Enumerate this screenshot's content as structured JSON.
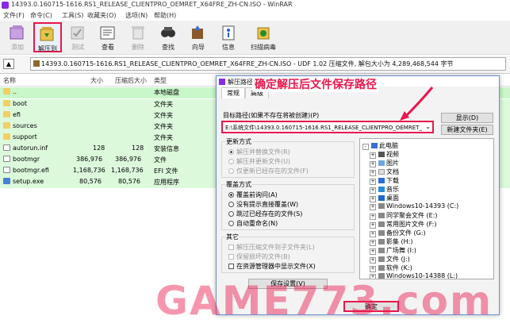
{
  "window": {
    "title": "14393.0.160715-1616.RS1_RELEASE_CLIENTPRO_OEMRET_X64FRE_ZH-CN.ISO - WinRAR"
  },
  "menu": [
    "文件(F)",
    "命令(C)",
    "工具(S)",
    "收藏夹(O)",
    "选项(N)",
    "帮助(H)"
  ],
  "toolbar": [
    {
      "label": "添加",
      "icon": "add-icon",
      "disabled": true
    },
    {
      "label": "解压到",
      "icon": "extract-to-icon",
      "highlighted": true
    },
    {
      "label": "测试",
      "icon": "test-icon",
      "disabled": true
    },
    {
      "label": "查看",
      "icon": "view-icon"
    },
    {
      "label": "删除",
      "icon": "delete-icon",
      "disabled": true
    },
    {
      "label": "查找",
      "icon": "find-icon"
    },
    {
      "label": "向导",
      "icon": "wizard-icon"
    },
    {
      "label": "信息",
      "icon": "info-icon"
    },
    {
      "label": "扫描病毒",
      "icon": "virus-scan-icon"
    }
  ],
  "address": {
    "path": "14393.0.160715-1616.RS1_RELEASE_CLIENTPRO_OEMRET_X64FRE_ZH-CN.ISO - UDF 1.02 压缩文件, 解包大小为 4,289,468,544 字节"
  },
  "columns": {
    "name": "名称",
    "size": "大小",
    "packed": "压缩后大小",
    "type": "类型"
  },
  "files": [
    {
      "name": "..",
      "size": "",
      "packed": "",
      "type": "本地磁盘",
      "kind": "folder"
    },
    {
      "name": "boot",
      "size": "",
      "packed": "",
      "type": "文件夹",
      "kind": "folder"
    },
    {
      "name": "efi",
      "size": "",
      "packed": "",
      "type": "文件夹",
      "kind": "folder"
    },
    {
      "name": "sources",
      "size": "",
      "packed": "",
      "type": "文件夹",
      "kind": "folder"
    },
    {
      "name": "support",
      "size": "",
      "packed": "",
      "type": "文件夹",
      "kind": "folder"
    },
    {
      "name": "autorun.inf",
      "size": "128",
      "packed": "128",
      "type": "安装信息",
      "kind": "file"
    },
    {
      "name": "bootmgr",
      "size": "386,976",
      "packed": "386,976",
      "type": "文件",
      "kind": "file"
    },
    {
      "name": "bootmgr.efi",
      "size": "1,168,736",
      "packed": "1,168,736",
      "type": "EFI 文件",
      "kind": "file"
    },
    {
      "name": "setup.exe",
      "size": "80,576",
      "packed": "80,576",
      "type": "应用程序",
      "kind": "exe"
    }
  ],
  "dialog": {
    "title": "解压路径和选项",
    "tabs": [
      "常规",
      "高级"
    ],
    "dest_label": "目标路径(如果不存在将被创建)(P)",
    "dest_value": "E:\\系统文件\\14393.0.160715-1616.RS1_RELEASE_CLIENTPRO_OEMRET_",
    "show_button": "显示(D)",
    "new_folder_button": "新建文件夹(E)",
    "update_mode": {
      "title": "更新方式",
      "options": [
        "解压并替换文件(R)",
        "解压并更新文件(U)",
        "仅更新已经存在的文件(F)"
      ]
    },
    "overwrite_mode": {
      "title": "覆盖方式",
      "options": [
        "覆盖前询问(A)",
        "没有提示直接覆盖(W)",
        "跳过已经存在的文件(S)",
        "自动重命名(N)"
      ]
    },
    "misc": {
      "title": "其它",
      "options": [
        "解压压缩文件到子文件夹(L)",
        "保留损坏的文件(B)",
        "在资源管理器中显示文件(X)"
      ]
    },
    "save_button": "保存设置(V)",
    "ok_button": "确定",
    "tree": [
      {
        "label": "此电脑",
        "level": 0
      },
      {
        "label": "视频",
        "level": 1
      },
      {
        "label": "图片",
        "level": 1
      },
      {
        "label": "文档",
        "level": 1
      },
      {
        "label": "下载",
        "level": 1
      },
      {
        "label": "音乐",
        "level": 1
      },
      {
        "label": "桌面",
        "level": 1
      },
      {
        "label": "Windows10-14393 (C:)",
        "level": 1
      },
      {
        "label": "同学聚会文件 (E:)",
        "level": 1
      },
      {
        "label": "常用图片文件 (F:)",
        "level": 1
      },
      {
        "label": "备份文件 (G:)",
        "level": 1
      },
      {
        "label": "影集 (H:)",
        "level": 1
      },
      {
        "label": "广场舞 (I:)",
        "level": 1
      },
      {
        "label": "文件 (J:)",
        "level": 1
      },
      {
        "label": "软件 (K:)",
        "level": 1
      },
      {
        "label": "Windows10-14388 (L:)",
        "level": 1
      }
    ]
  },
  "annotation": "确定解压后文件保存路径",
  "watermark": "GAME773.com",
  "colors": {
    "highlight": "#e8174c",
    "selection": "#c9f7c9"
  }
}
